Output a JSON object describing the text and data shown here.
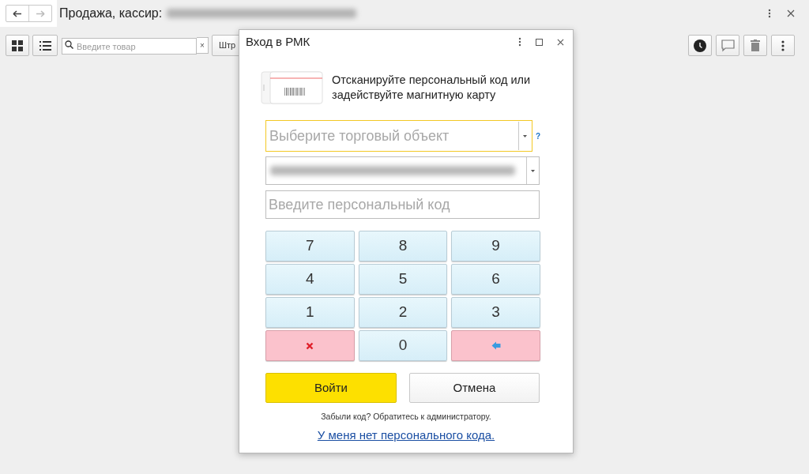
{
  "window": {
    "title": "Продажа, кассир:",
    "has_redacted_name": true
  },
  "toolbar": {
    "search": {
      "placeholder": "Введите товар"
    },
    "clear_label": "×",
    "barcode_button": "Штр"
  },
  "dialog": {
    "title": "Вход в РМК",
    "instruction": "Отсканируйте персональный код или задействуйте магнитную карту",
    "store_field": {
      "placeholder": "Выберите торговый объект",
      "focused": true,
      "help": "?"
    },
    "cashier_field": {
      "redacted": true
    },
    "code_field": {
      "placeholder": "Введите персональный код"
    },
    "keys": [
      {
        "kind": "digit",
        "label": "7"
      },
      {
        "kind": "digit",
        "label": "8"
      },
      {
        "kind": "digit",
        "label": "9"
      },
      {
        "kind": "digit",
        "label": "4"
      },
      {
        "kind": "digit",
        "label": "5"
      },
      {
        "kind": "digit",
        "label": "6"
      },
      {
        "kind": "digit",
        "label": "1"
      },
      {
        "kind": "digit",
        "label": "2"
      },
      {
        "kind": "digit",
        "label": "3"
      },
      {
        "kind": "clear"
      },
      {
        "kind": "digit",
        "label": "0"
      },
      {
        "kind": "backspace"
      }
    ],
    "login_button": "Войти",
    "cancel_button": "Отмена",
    "hint": "Забыли код? Обратитесь к администратору.",
    "no_code_link": "У меня нет персонального кода."
  }
}
